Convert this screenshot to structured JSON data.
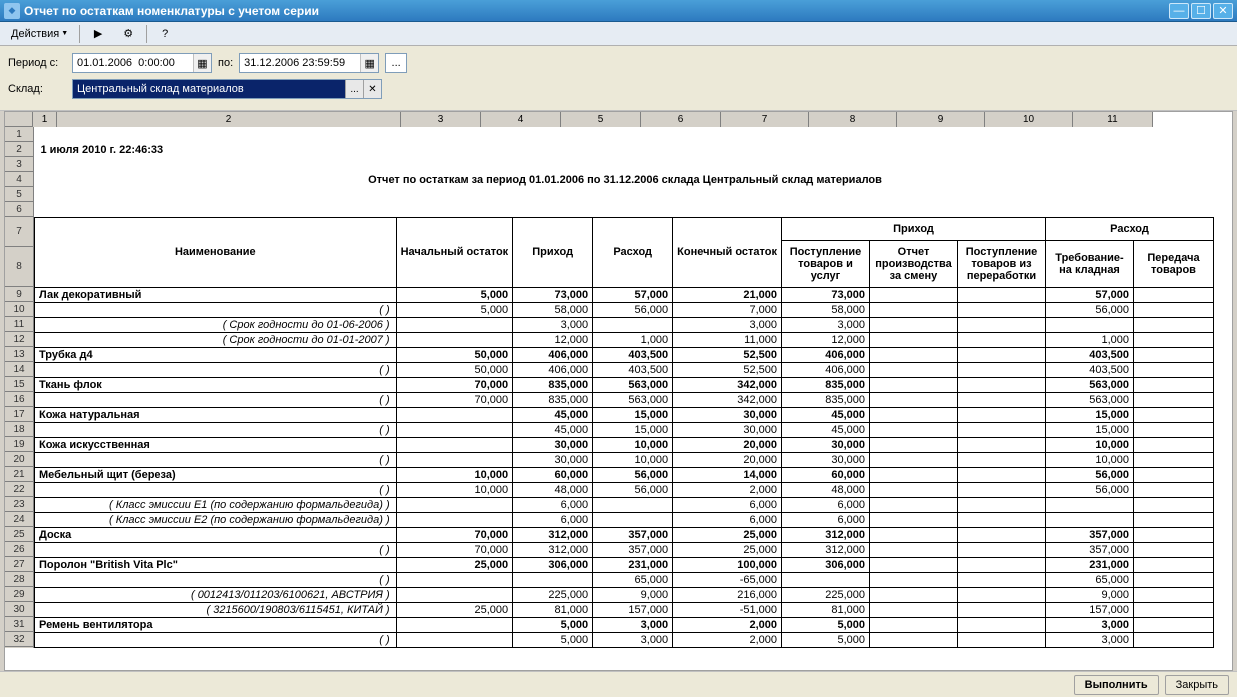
{
  "window": {
    "title": "Отчет по остаткам номенклатуры с учетом серии"
  },
  "toolbar": {
    "actions": "Действия"
  },
  "params": {
    "period_label": "Период с:",
    "period_from": "01.01.2006  0:00:00",
    "to_label": "по:",
    "period_to": "31.12.2006 23:59:59",
    "warehouse_label": "Склад:",
    "warehouse": "Центральный склад материалов"
  },
  "report": {
    "timestamp": "1 июля 2010 г. 22:46:33",
    "title": "Отчет по остаткам за период 01.01.2006 по 31.12.2006 склада Центральный склад материалов",
    "headers": {
      "name": "Наименование",
      "start": "Начальный остаток",
      "in": "Приход",
      "out": "Расход",
      "end": "Конечный остаток",
      "in_group": "Приход",
      "out_group": "Расход",
      "in1": "Поступление товаров и услуг",
      "in2": "Отчет производства за смену",
      "in3": "Поступление товаров из переработки",
      "out1": "Требование-на кладная",
      "out2": "Передача товаров"
    },
    "cols": [
      "1",
      "2",
      "3",
      "4",
      "5",
      "6",
      "7",
      "8",
      "9",
      "10",
      "11"
    ],
    "rows": [
      {
        "n": 9,
        "bold": true,
        "name": "Лак декоративный",
        "v": [
          "5,000",
          "73,000",
          "57,000",
          "21,000",
          "73,000",
          "",
          "",
          "57,000",
          ""
        ]
      },
      {
        "n": 10,
        "sub": true,
        "name": "(   )",
        "v": [
          "5,000",
          "58,000",
          "56,000",
          "7,000",
          "58,000",
          "",
          "",
          "56,000",
          ""
        ]
      },
      {
        "n": 11,
        "sub": true,
        "name": "( Срок годности до 01-06-2006 )",
        "v": [
          "",
          "3,000",
          "",
          "3,000",
          "3,000",
          "",
          "",
          "",
          ""
        ]
      },
      {
        "n": 12,
        "sub": true,
        "name": "( Срок годности до 01-01-2007 )",
        "v": [
          "",
          "12,000",
          "1,000",
          "11,000",
          "12,000",
          "",
          "",
          "1,000",
          ""
        ]
      },
      {
        "n": 13,
        "bold": true,
        "name": "Трубка д4",
        "v": [
          "50,000",
          "406,000",
          "403,500",
          "52,500",
          "406,000",
          "",
          "",
          "403,500",
          ""
        ]
      },
      {
        "n": 14,
        "sub": true,
        "name": "(   )",
        "v": [
          "50,000",
          "406,000",
          "403,500",
          "52,500",
          "406,000",
          "",
          "",
          "403,500",
          ""
        ]
      },
      {
        "n": 15,
        "bold": true,
        "name": "Ткань флок",
        "v": [
          "70,000",
          "835,000",
          "563,000",
          "342,000",
          "835,000",
          "",
          "",
          "563,000",
          ""
        ]
      },
      {
        "n": 16,
        "sub": true,
        "name": "(   )",
        "v": [
          "70,000",
          "835,000",
          "563,000",
          "342,000",
          "835,000",
          "",
          "",
          "563,000",
          ""
        ]
      },
      {
        "n": 17,
        "bold": true,
        "name": "Кожа натуральная",
        "v": [
          "",
          "45,000",
          "15,000",
          "30,000",
          "45,000",
          "",
          "",
          "15,000",
          ""
        ]
      },
      {
        "n": 18,
        "sub": true,
        "name": "(   )",
        "v": [
          "",
          "45,000",
          "15,000",
          "30,000",
          "45,000",
          "",
          "",
          "15,000",
          ""
        ]
      },
      {
        "n": 19,
        "bold": true,
        "name": "Кожа искусственная",
        "v": [
          "",
          "30,000",
          "10,000",
          "20,000",
          "30,000",
          "",
          "",
          "10,000",
          ""
        ]
      },
      {
        "n": 20,
        "sub": true,
        "name": "(   )",
        "v": [
          "",
          "30,000",
          "10,000",
          "20,000",
          "30,000",
          "",
          "",
          "10,000",
          ""
        ]
      },
      {
        "n": 21,
        "bold": true,
        "name": "Мебельный щит (береза)",
        "v": [
          "10,000",
          "60,000",
          "56,000",
          "14,000",
          "60,000",
          "",
          "",
          "56,000",
          ""
        ]
      },
      {
        "n": 22,
        "sub": true,
        "name": "(   )",
        "v": [
          "10,000",
          "48,000",
          "56,000",
          "2,000",
          "48,000",
          "",
          "",
          "56,000",
          ""
        ]
      },
      {
        "n": 23,
        "sub": true,
        "name": "( Класс эмиссии Е1 (по содержанию формальдегида) )",
        "v": [
          "",
          "6,000",
          "",
          "6,000",
          "6,000",
          "",
          "",
          "",
          ""
        ]
      },
      {
        "n": 24,
        "sub": true,
        "name": "( Класс эмиссии Е2 (по содержанию формальдегида) )",
        "v": [
          "",
          "6,000",
          "",
          "6,000",
          "6,000",
          "",
          "",
          "",
          ""
        ]
      },
      {
        "n": 25,
        "bold": true,
        "name": "Доска",
        "v": [
          "70,000",
          "312,000",
          "357,000",
          "25,000",
          "312,000",
          "",
          "",
          "357,000",
          ""
        ]
      },
      {
        "n": 26,
        "sub": true,
        "name": "(   )",
        "v": [
          "70,000",
          "312,000",
          "357,000",
          "25,000",
          "312,000",
          "",
          "",
          "357,000",
          ""
        ]
      },
      {
        "n": 27,
        "bold": true,
        "name": "Поролон \"British Vita Plc\"",
        "v": [
          "25,000",
          "306,000",
          "231,000",
          "100,000",
          "306,000",
          "",
          "",
          "231,000",
          ""
        ]
      },
      {
        "n": 28,
        "sub": true,
        "name": "(   )",
        "v": [
          "",
          "",
          "65,000",
          "-65,000",
          "",
          "",
          "",
          "65,000",
          ""
        ]
      },
      {
        "n": 29,
        "sub": true,
        "name": "( 0012413/011203/6100621, АВСТРИЯ )",
        "v": [
          "",
          "225,000",
          "9,000",
          "216,000",
          "225,000",
          "",
          "",
          "9,000",
          ""
        ]
      },
      {
        "n": 30,
        "sub": true,
        "name": "( 3215600/190803/6115451, КИТАЙ )",
        "v": [
          "25,000",
          "81,000",
          "157,000",
          "-51,000",
          "81,000",
          "",
          "",
          "157,000",
          ""
        ]
      },
      {
        "n": 31,
        "bold": true,
        "name": "Ремень вентилятора",
        "v": [
          "",
          "5,000",
          "3,000",
          "2,000",
          "5,000",
          "",
          "",
          "3,000",
          ""
        ]
      },
      {
        "n": 32,
        "sub": true,
        "name": "(   )",
        "v": [
          "",
          "5,000",
          "3,000",
          "2,000",
          "5,000",
          "",
          "",
          "3,000",
          ""
        ]
      }
    ]
  },
  "footer": {
    "run": "Выполнить",
    "close": "Закрыть"
  }
}
